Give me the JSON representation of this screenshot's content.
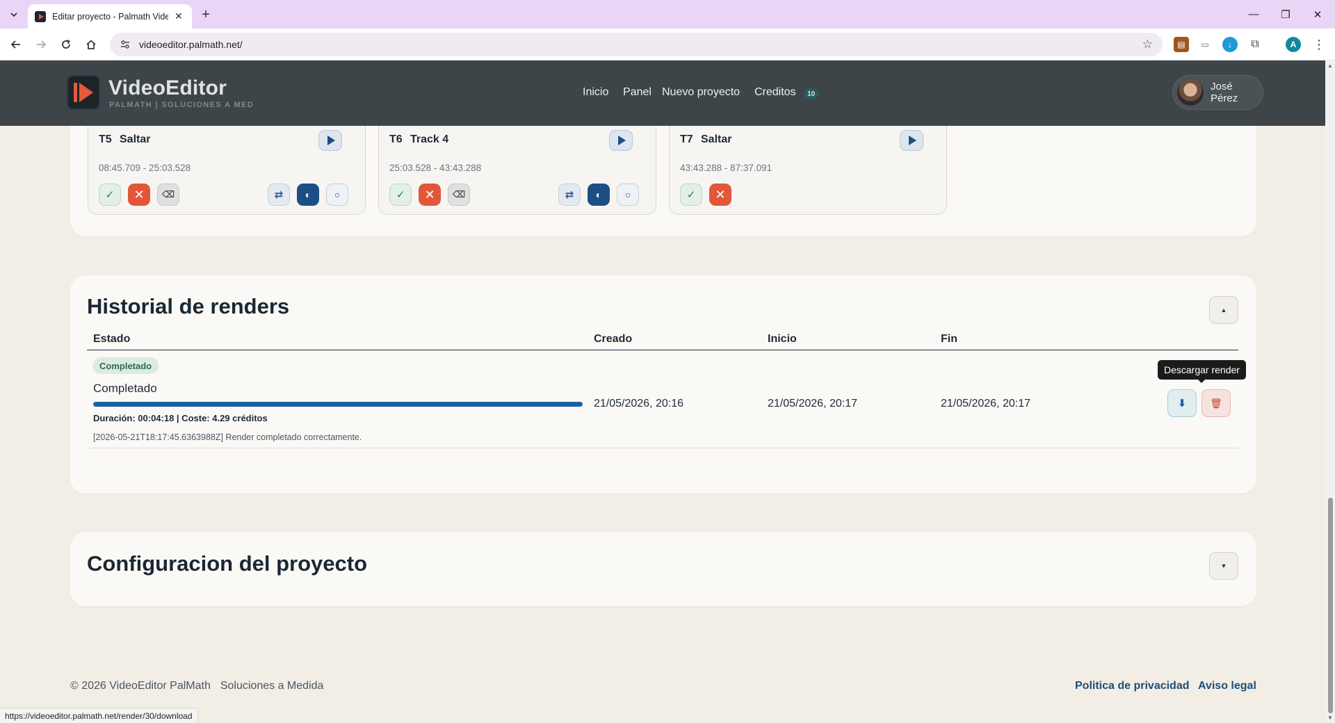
{
  "browser": {
    "tab_title": "Editar proyecto - Palmath VideoEditor",
    "url": "videoeditor.palmath.net/",
    "status_url": "https://videoeditor.palmath.net/render/30/download",
    "profile_initial": "A"
  },
  "header": {
    "brand_name": "VideoEditor",
    "brand_tagline": "PALMATH | SOLUCIONES A MED",
    "nav": [
      "Inicio",
      "Panel",
      "Nuevo proyecto",
      "Creditos"
    ],
    "credits_count": "10",
    "user_name": "José Pérez"
  },
  "tracks": [
    {
      "id": "T5",
      "name": "Saltar",
      "time": "08:45.709 - 25:03.528"
    },
    {
      "id": "T6",
      "name": "Track 4",
      "time": "25:03.528 - 43:43.288"
    },
    {
      "id": "T7",
      "name": "Saltar",
      "time": "43:43.288 - 87:37.091"
    }
  ],
  "history": {
    "title": "Historial de renders",
    "columns": [
      "Estado",
      "Creado",
      "Inicio",
      "Fin"
    ],
    "row": {
      "badge": "Completado",
      "status": "Completado",
      "progress": 1.0,
      "meta": "Duración: 00:04:18 | Coste: 4.29 créditos",
      "log": "[2026-05-21T18:17:45.6363988Z] Render completado correctamente.",
      "created": "21/05/2026, 20:16",
      "start": "21/05/2026, 20:17",
      "end": "21/05/2026, 20:17"
    },
    "tooltip": "Descargar render"
  },
  "config": {
    "title": "Configuracion del proyecto"
  },
  "footer": {
    "copyright": "© 2026 VideoEditor PalMath",
    "tagline": "Soluciones a Medida",
    "links": [
      "Politica de privacidad",
      "Aviso legal"
    ]
  },
  "colors": {
    "accent": "#1c4e85",
    "danger": "#e2573a",
    "success": "#2d6b4f",
    "header_bg": "#3d4549"
  }
}
